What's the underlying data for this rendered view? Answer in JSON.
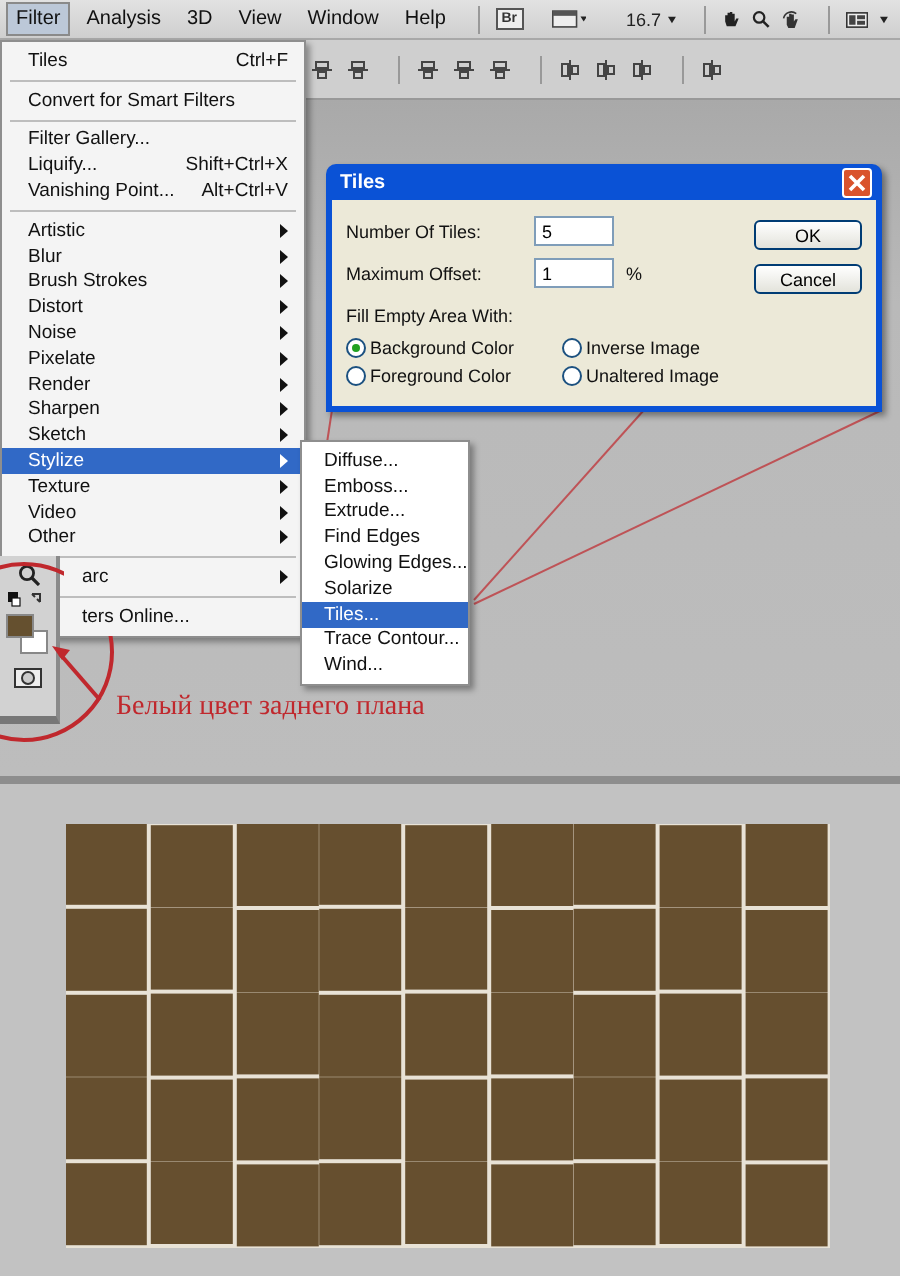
{
  "menu_bar": {
    "items": [
      {
        "label": "Filter",
        "selected": true
      },
      {
        "label": "Analysis",
        "selected": false
      },
      {
        "label": "3D",
        "selected": false
      },
      {
        "label": "View",
        "selected": false
      },
      {
        "label": "Window",
        "selected": false
      },
      {
        "label": "Help",
        "selected": false
      }
    ],
    "bridge_button": "Br",
    "zoom": "16.7"
  },
  "filter_menu": {
    "items": [
      {
        "kind": "item",
        "label": "Tiles",
        "shortcut": "Ctrl+F",
        "submenu": false,
        "selected": false
      },
      {
        "kind": "separator"
      },
      {
        "kind": "item",
        "label": "Convert for Smart Filters",
        "submenu": false,
        "selected": false
      },
      {
        "kind": "separator"
      },
      {
        "kind": "item",
        "label": "Filter Gallery...",
        "submenu": false,
        "selected": false
      },
      {
        "kind": "item",
        "label": "Liquify...",
        "shortcut": "Shift+Ctrl+X",
        "submenu": false,
        "selected": false
      },
      {
        "kind": "item",
        "label": "Vanishing Point...",
        "shortcut": "Alt+Ctrl+V",
        "submenu": false,
        "selected": false
      },
      {
        "kind": "separator"
      },
      {
        "kind": "item",
        "label": "Artistic",
        "submenu": true,
        "selected": false
      },
      {
        "kind": "item",
        "label": "Blur",
        "submenu": true,
        "selected": false
      },
      {
        "kind": "item",
        "label": "Brush Strokes",
        "submenu": true,
        "selected": false
      },
      {
        "kind": "item",
        "label": "Distort",
        "submenu": true,
        "selected": false
      },
      {
        "kind": "item",
        "label": "Noise",
        "submenu": true,
        "selected": false
      },
      {
        "kind": "item",
        "label": "Pixelate",
        "submenu": true,
        "selected": false
      },
      {
        "kind": "item",
        "label": "Render",
        "submenu": true,
        "selected": false
      },
      {
        "kind": "item",
        "label": "Sharpen",
        "submenu": true,
        "selected": false
      },
      {
        "kind": "item",
        "label": "Sketch",
        "submenu": true,
        "selected": false
      },
      {
        "kind": "item",
        "label": "Stylize",
        "submenu": true,
        "selected": true
      },
      {
        "kind": "item",
        "label": "Texture",
        "submenu": true,
        "selected": false
      },
      {
        "kind": "item",
        "label": "Video",
        "submenu": true,
        "selected": false
      },
      {
        "kind": "item",
        "label": "Other",
        "submenu": true,
        "selected": false
      },
      {
        "kind": "separator"
      },
      {
        "kind": "covered",
        "label": "arc",
        "submenu": true,
        "selected": false
      },
      {
        "kind": "separator"
      },
      {
        "kind": "covered",
        "label": "ters Online...",
        "submenu": false,
        "selected": false
      }
    ]
  },
  "submenu": {
    "items": [
      {
        "label": "Diffuse...",
        "selected": false
      },
      {
        "label": "Emboss...",
        "selected": false
      },
      {
        "label": "Extrude...",
        "selected": false
      },
      {
        "label": "Find Edges",
        "selected": false
      },
      {
        "label": "Glowing Edges...",
        "selected": false
      },
      {
        "label": "Solarize",
        "selected": false
      },
      {
        "label": "Tiles...",
        "selected": true
      },
      {
        "label": "Trace Contour...",
        "selected": false
      },
      {
        "label": "Wind...",
        "selected": false
      }
    ]
  },
  "dialog": {
    "title": "Tiles",
    "fields": [
      {
        "label": "Number Of Tiles:",
        "value": "5"
      },
      {
        "label": "Maximum Offset:",
        "value": "1",
        "unit": "%"
      }
    ],
    "fill_label": "Fill Empty Area With:",
    "options": [
      {
        "label": "Background Color",
        "selected": true
      },
      {
        "label": "Inverse Image",
        "selected": false
      },
      {
        "label": "Foreground Color",
        "selected": false
      },
      {
        "label": "Unaltered Image",
        "selected": false
      }
    ],
    "buttons": [
      "OK",
      "Cancel"
    ]
  },
  "tools": {
    "swatches": [
      {
        "kind": "foreground",
        "color": "#65502f"
      },
      {
        "kind": "background",
        "color": "#ffffff"
      }
    ]
  },
  "annotation": {
    "label": "Белый цвет заднего плана"
  }
}
